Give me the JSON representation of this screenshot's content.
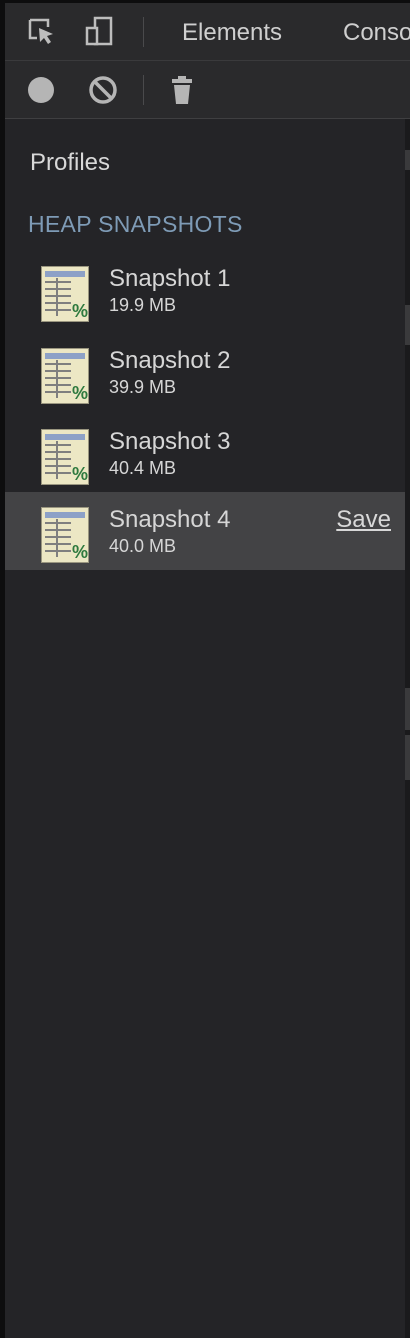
{
  "toolbar": {
    "tabs": [
      {
        "label": "Elements"
      },
      {
        "label": "Conso"
      }
    ],
    "icons": [
      "inspect-element-icon",
      "device-toggle-icon"
    ]
  },
  "profiler_toolbar": {
    "icons": [
      "record-icon",
      "clear-icon",
      "trash-icon"
    ]
  },
  "sidebar": {
    "title": "Profiles",
    "group_title": "HEAP SNAPSHOTS",
    "snapshots": [
      {
        "name": "Snapshot 1",
        "size": "19.9 MB"
      },
      {
        "name": "Snapshot 2",
        "size": "39.9 MB"
      },
      {
        "name": "Snapshot 3",
        "size": "40.4 MB"
      },
      {
        "name": "Snapshot 4",
        "size": "40.0 MB",
        "action": "Save",
        "selected": true
      }
    ]
  },
  "colors": {
    "group_title": "#7e9bb6",
    "selected_row": "#434345",
    "background": "#242427"
  }
}
